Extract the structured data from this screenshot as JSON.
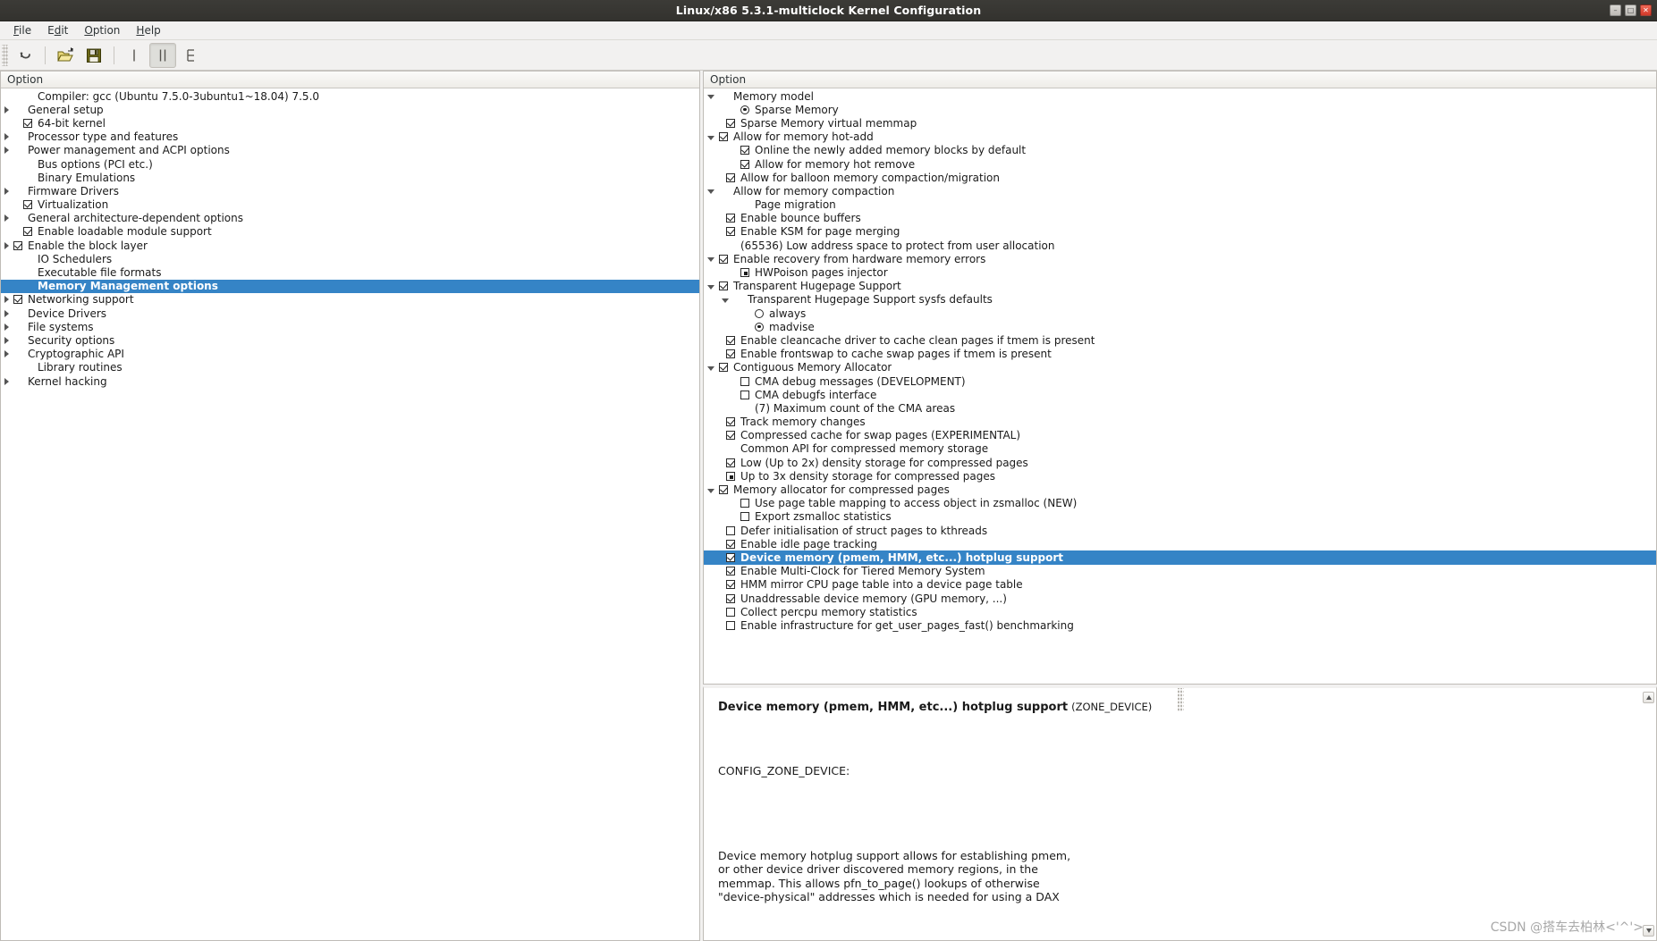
{
  "window": {
    "title": "Linux/x86 5.3.1-multiclock Kernel Configuration",
    "minimize_label": "–",
    "maximize_label": "□",
    "close_label": "✕"
  },
  "menubar": [
    {
      "label": "File",
      "mnemonic": "F"
    },
    {
      "label": "Edit",
      "mnemonic": "E"
    },
    {
      "label": "Option",
      "mnemonic": "O"
    },
    {
      "label": "Help",
      "mnemonic": "H"
    }
  ],
  "toolbar": [
    {
      "name": "back-undo-icon",
      "label": "Back"
    },
    {
      "name": "open-folder-icon",
      "label": "Load"
    },
    {
      "name": "save-floppy-icon",
      "label": "Save"
    },
    {
      "name": "single-view-icon",
      "label": "Single View"
    },
    {
      "name": "split-view-icon",
      "label": "Split View",
      "pressed": true
    },
    {
      "name": "full-view-icon",
      "label": "Full View"
    }
  ],
  "left_pane": {
    "column_header": "Option",
    "rows": [
      {
        "indent": 1,
        "arrow": "none",
        "glyph": "none",
        "label": "Compiler: gcc (Ubuntu 7.5.0-3ubuntu1~18.04) 7.5.0"
      },
      {
        "indent": 0,
        "arrow": "right",
        "glyph": "none",
        "label": "General setup"
      },
      {
        "indent": 1,
        "arrow": "none",
        "glyph": "checked",
        "label": "64-bit kernel"
      },
      {
        "indent": 0,
        "arrow": "right",
        "glyph": "none",
        "label": "Processor type and features"
      },
      {
        "indent": 0,
        "arrow": "right",
        "glyph": "none",
        "label": "Power management and ACPI options"
      },
      {
        "indent": 1,
        "arrow": "none",
        "glyph": "none",
        "label": "Bus options (PCI etc.)"
      },
      {
        "indent": 1,
        "arrow": "none",
        "glyph": "none",
        "label": "Binary Emulations"
      },
      {
        "indent": 0,
        "arrow": "right",
        "glyph": "none",
        "label": "Firmware Drivers"
      },
      {
        "indent": 1,
        "arrow": "none",
        "glyph": "checked",
        "label": "Virtualization"
      },
      {
        "indent": 0,
        "arrow": "right",
        "glyph": "none",
        "label": "General architecture-dependent options"
      },
      {
        "indent": 1,
        "arrow": "none",
        "glyph": "checked",
        "label": "Enable loadable module support"
      },
      {
        "indent": 0,
        "arrow": "right",
        "glyph": "checked",
        "label": "Enable the block layer"
      },
      {
        "indent": 1,
        "arrow": "none",
        "glyph": "none",
        "label": "IO Schedulers"
      },
      {
        "indent": 1,
        "arrow": "none",
        "glyph": "none",
        "label": "Executable file formats"
      },
      {
        "indent": 1,
        "arrow": "none",
        "glyph": "none",
        "label": "Memory Management options",
        "selected": true
      },
      {
        "indent": 0,
        "arrow": "right",
        "glyph": "checked",
        "label": "Networking support"
      },
      {
        "indent": 0,
        "arrow": "right",
        "glyph": "none",
        "label": "Device Drivers"
      },
      {
        "indent": 0,
        "arrow": "right",
        "glyph": "none",
        "label": "File systems"
      },
      {
        "indent": 0,
        "arrow": "right",
        "glyph": "none",
        "label": "Security options"
      },
      {
        "indent": 0,
        "arrow": "right",
        "glyph": "none",
        "label": "Cryptographic API"
      },
      {
        "indent": 1,
        "arrow": "none",
        "glyph": "none",
        "label": "Library routines"
      },
      {
        "indent": 0,
        "arrow": "right",
        "glyph": "none",
        "label": "Kernel hacking"
      }
    ]
  },
  "right_pane": {
    "column_header": "Option",
    "rows": [
      {
        "indent": 0,
        "arrow": "down",
        "glyph": "none",
        "label": "Memory model"
      },
      {
        "indent": 2,
        "arrow": "none",
        "glyph": "radio-on",
        "label": "Sparse Memory"
      },
      {
        "indent": 1,
        "arrow": "none",
        "glyph": "checked",
        "label": "Sparse Memory virtual memmap"
      },
      {
        "indent": 0,
        "arrow": "down",
        "glyph": "checked",
        "label": "Allow for memory hot-add"
      },
      {
        "indent": 2,
        "arrow": "none",
        "glyph": "checked",
        "label": "Online the newly added memory blocks by default"
      },
      {
        "indent": 2,
        "arrow": "none",
        "glyph": "checked",
        "label": "Allow for memory hot remove"
      },
      {
        "indent": 1,
        "arrow": "none",
        "glyph": "checked",
        "label": "Allow for balloon memory compaction/migration"
      },
      {
        "indent": 0,
        "arrow": "down",
        "glyph": "none",
        "label": "Allow for memory compaction"
      },
      {
        "indent": 2,
        "arrow": "none",
        "glyph": "none",
        "label": "Page migration"
      },
      {
        "indent": 1,
        "arrow": "none",
        "glyph": "checked",
        "label": "Enable bounce buffers"
      },
      {
        "indent": 1,
        "arrow": "none",
        "glyph": "checked",
        "label": "Enable KSM for page merging"
      },
      {
        "indent": 1,
        "arrow": "none",
        "glyph": "none",
        "label": "(65536) Low address space to protect from user allocation"
      },
      {
        "indent": 0,
        "arrow": "down",
        "glyph": "checked",
        "label": "Enable recovery from hardware memory errors"
      },
      {
        "indent": 2,
        "arrow": "none",
        "glyph": "module",
        "label": "HWPoison pages injector"
      },
      {
        "indent": 0,
        "arrow": "down",
        "glyph": "checked",
        "label": "Transparent Hugepage Support"
      },
      {
        "indent": 1,
        "arrow": "down",
        "glyph": "none",
        "label": "Transparent Hugepage Support sysfs defaults"
      },
      {
        "indent": 3,
        "arrow": "none",
        "glyph": "radio-off",
        "label": "always"
      },
      {
        "indent": 3,
        "arrow": "none",
        "glyph": "radio-on",
        "label": "madvise"
      },
      {
        "indent": 1,
        "arrow": "none",
        "glyph": "checked",
        "label": "Enable cleancache driver to cache clean pages if tmem is present"
      },
      {
        "indent": 1,
        "arrow": "none",
        "glyph": "checked",
        "label": "Enable frontswap to cache swap pages if tmem is present"
      },
      {
        "indent": 0,
        "arrow": "down",
        "glyph": "checked",
        "label": "Contiguous Memory Allocator"
      },
      {
        "indent": 2,
        "arrow": "none",
        "glyph": "unchecked",
        "label": "CMA debug messages (DEVELOPMENT)"
      },
      {
        "indent": 2,
        "arrow": "none",
        "glyph": "unchecked",
        "label": "CMA debugfs interface"
      },
      {
        "indent": 2,
        "arrow": "none",
        "glyph": "none",
        "label": "(7) Maximum count of the CMA areas"
      },
      {
        "indent": 1,
        "arrow": "none",
        "glyph": "checked",
        "label": "Track memory changes"
      },
      {
        "indent": 1,
        "arrow": "none",
        "glyph": "checked",
        "label": "Compressed cache for swap pages (EXPERIMENTAL)"
      },
      {
        "indent": 1,
        "arrow": "none",
        "glyph": "none",
        "label": "Common API for compressed memory storage"
      },
      {
        "indent": 1,
        "arrow": "none",
        "glyph": "checked",
        "label": "Low (Up to 2x) density storage for compressed pages"
      },
      {
        "indent": 1,
        "arrow": "none",
        "glyph": "module",
        "label": "Up to 3x density storage for compressed pages"
      },
      {
        "indent": 0,
        "arrow": "down",
        "glyph": "checked",
        "label": "Memory allocator for compressed pages"
      },
      {
        "indent": 2,
        "arrow": "none",
        "glyph": "unchecked",
        "label": "Use page table mapping to access object in zsmalloc (NEW)"
      },
      {
        "indent": 2,
        "arrow": "none",
        "glyph": "unchecked",
        "label": "Export zsmalloc statistics"
      },
      {
        "indent": 1,
        "arrow": "none",
        "glyph": "unchecked",
        "label": "Defer initialisation of struct pages to kthreads"
      },
      {
        "indent": 1,
        "arrow": "none",
        "glyph": "checked",
        "label": "Enable idle page tracking"
      },
      {
        "indent": 1,
        "arrow": "none",
        "glyph": "checked",
        "label": "Device memory (pmem, HMM, etc...) hotplug support",
        "selected": true
      },
      {
        "indent": 1,
        "arrow": "none",
        "glyph": "checked",
        "label": "Enable Multi-Clock for Tiered Memory System"
      },
      {
        "indent": 1,
        "arrow": "none",
        "glyph": "checked",
        "label": "HMM mirror CPU page table into a device page table"
      },
      {
        "indent": 1,
        "arrow": "none",
        "glyph": "checked",
        "label": "Unaddressable device memory (GPU memory, ...)"
      },
      {
        "indent": 1,
        "arrow": "none",
        "glyph": "unchecked",
        "label": "Collect percpu memory statistics"
      },
      {
        "indent": 1,
        "arrow": "none",
        "glyph": "unchecked",
        "label": "Enable infrastructure for get_user_pages_fast() benchmarking"
      }
    ]
  },
  "help_panel": {
    "title": "Device memory (pmem, HMM, etc...) hotplug support",
    "symbol": "(ZONE_DEVICE)",
    "config_line": "CONFIG_ZONE_DEVICE:",
    "body_lines": [
      "Device memory hotplug support allows for establishing pmem,",
      "or other device driver discovered memory regions, in the",
      "memmap. This allows pfn_to_page() lookups of otherwise",
      "\"device-physical\" addresses which is needed for using a DAX"
    ]
  },
  "watermark": "CSDN @搭车去柏林<'^'>",
  "colors": {
    "selection": "#3584c6",
    "titlebar": "#3c3b37",
    "panel_bg": "#f2f1f0"
  }
}
